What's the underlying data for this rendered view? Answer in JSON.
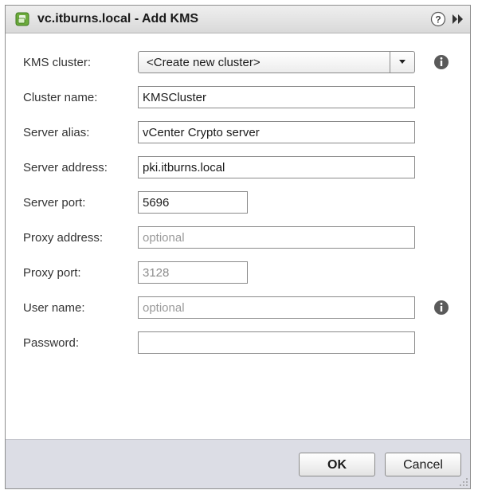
{
  "dialog": {
    "title": "vc.itburns.local - Add KMS"
  },
  "form": {
    "kms_cluster": {
      "label": "KMS cluster:",
      "selected": "<Create new cluster>"
    },
    "cluster_name": {
      "label": "Cluster name:",
      "value": "KMSCluster"
    },
    "server_alias": {
      "label": "Server alias:",
      "value": "vCenter Crypto server"
    },
    "server_address": {
      "label": "Server address:",
      "value": "pki.itburns.local"
    },
    "server_port": {
      "label": "Server port:",
      "value": "5696"
    },
    "proxy_address": {
      "label": "Proxy address:",
      "placeholder": "optional"
    },
    "proxy_port": {
      "label": "Proxy port:",
      "value": "3128"
    },
    "user_name": {
      "label": "User name:",
      "placeholder": "optional"
    },
    "password": {
      "label": "Password:",
      "value": ""
    }
  },
  "buttons": {
    "ok_label": "OK",
    "cancel_label": "Cancel"
  },
  "icons": {
    "app": "vcenter-app-icon",
    "help": "help-icon",
    "expand": "double-chevron-right-icon",
    "info": "info-icon",
    "dropdown": "chevron-down-icon",
    "resize": "resize-grip-icon"
  },
  "colors": {
    "titlebar": "#e3e3e3",
    "footer": "#dcdde5",
    "border": "#8a8a8a",
    "app_icon": "#6cab3c"
  }
}
